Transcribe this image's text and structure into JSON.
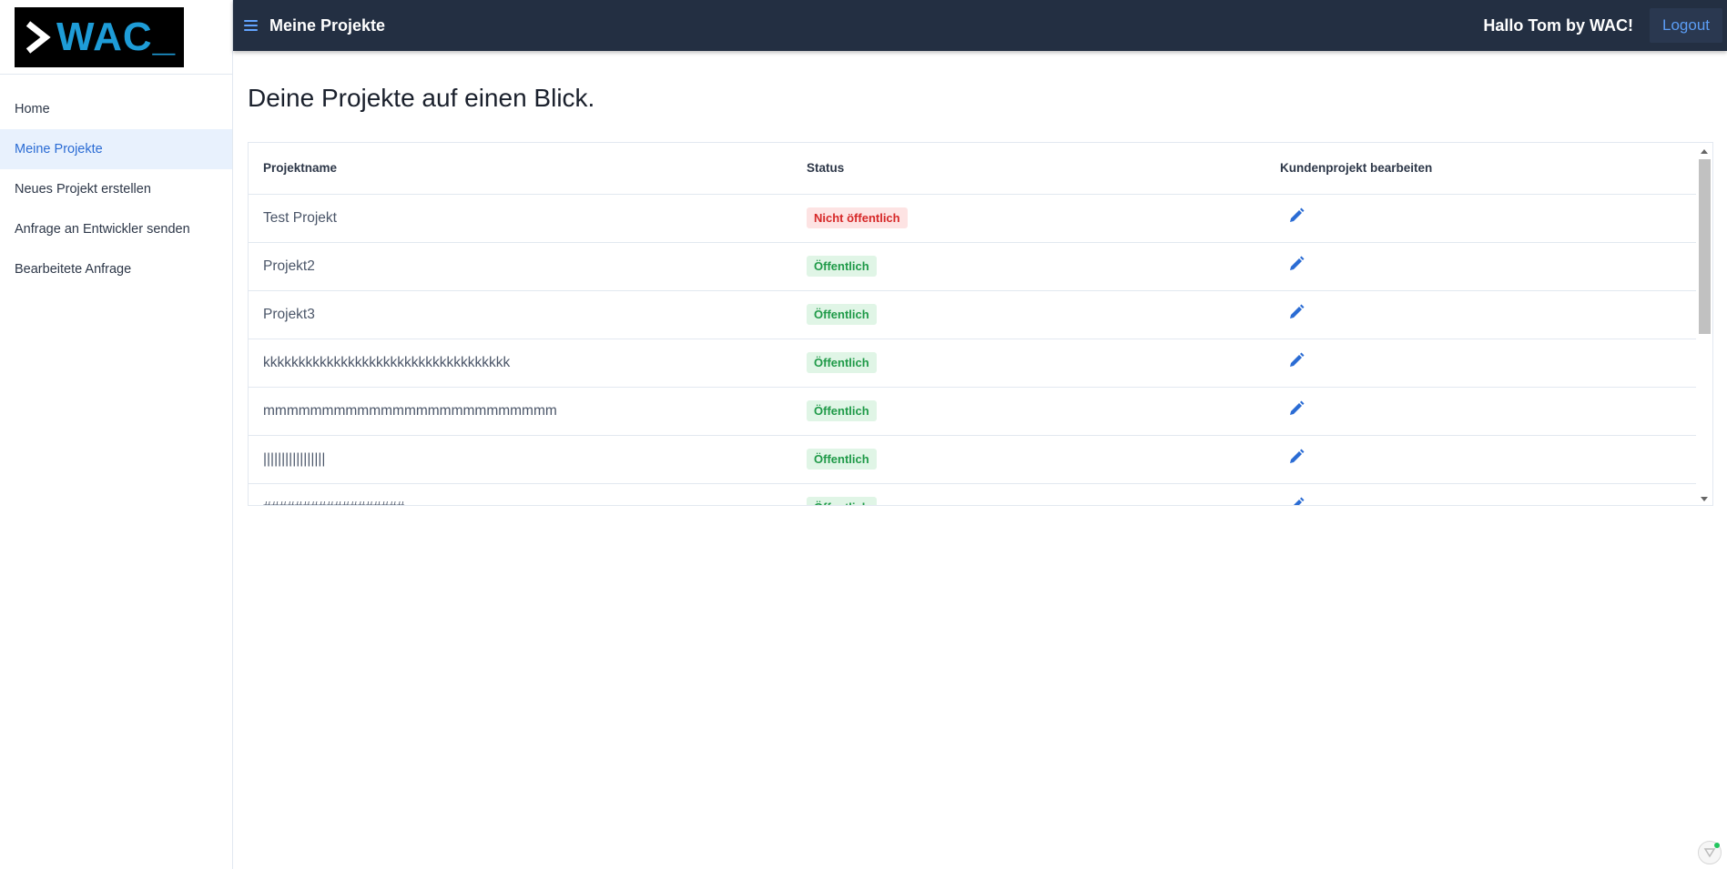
{
  "logo": {
    "text": "WAC_",
    "icon": "chevron-right-icon"
  },
  "sidebar": {
    "items": [
      {
        "label": "Home",
        "active": false
      },
      {
        "label": "Meine Projekte",
        "active": true
      },
      {
        "label": "Neues Projekt erstellen",
        "active": false
      },
      {
        "label": "Anfrage an Entwickler senden",
        "active": false
      },
      {
        "label": "Bearbeitete Anfrage",
        "active": false
      }
    ]
  },
  "header": {
    "menu_icon": "hamburger-menu-icon",
    "title": "Meine Projekte",
    "greeting": "Hallo Tom by WAC!",
    "logout_label": "Logout"
  },
  "main": {
    "title": "Deine Projekte auf einen Blick.",
    "table": {
      "columns": [
        "Projektname",
        "Status",
        "Kundenprojekt bearbeiten"
      ],
      "rows": [
        {
          "name": "Test Projekt",
          "status": "Nicht öffentlich",
          "status_type": "private"
        },
        {
          "name": "Projekt2",
          "status": "Öffentlich",
          "status_type": "public"
        },
        {
          "name": "Projekt3",
          "status": "Öffentlich",
          "status_type": "public"
        },
        {
          "name": "kkkkkkkkkkkkkkkkkkkkkkkkkkkkkkkkkkk",
          "status": "Öffentlich",
          "status_type": "public"
        },
        {
          "name": "mmmmmmmmmmmmmmmmmmmmmmmmm",
          "status": "Öffentlich",
          "status_type": "public"
        },
        {
          "name": "|||||||||||||||||",
          "status": "Öffentlich",
          "status_type": "public"
        },
        {
          "name": "##################",
          "status": "Öffentlich",
          "status_type": "public"
        }
      ],
      "edit_icon": "pencil-icon"
    }
  },
  "colors": {
    "header_bg": "#232f42",
    "accent": "#2b6cd4",
    "logo_text": "#1e9cd7",
    "private_badge_bg": "#fde3e3",
    "private_badge_text": "#d62828",
    "public_badge_bg": "#e0f5e6",
    "public_badge_text": "#1f9a48"
  }
}
